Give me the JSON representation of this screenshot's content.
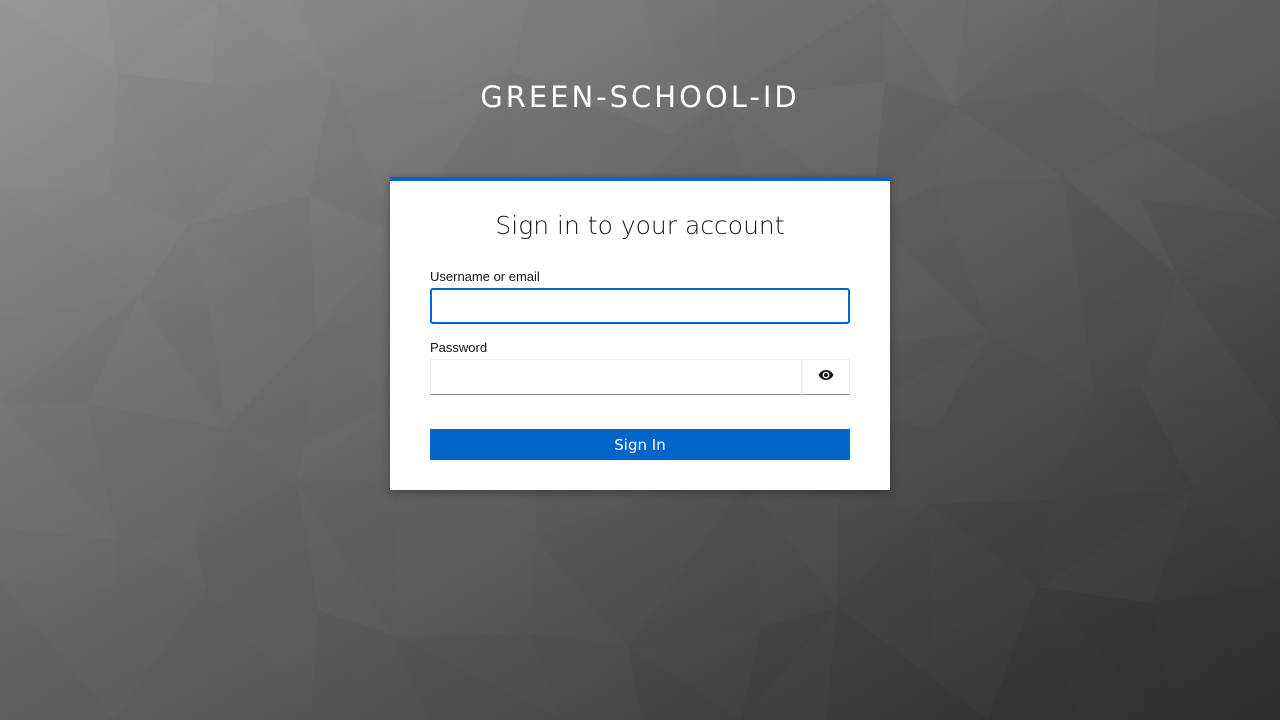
{
  "brand": {
    "title": "GREEN-SCHOOL-ID"
  },
  "login": {
    "heading": "Sign in to your account",
    "username_label": "Username or email",
    "username_value": "",
    "password_label": "Password",
    "password_value": "",
    "toggle_icon": "eye-icon",
    "submit_label": "Sign In"
  },
  "colors": {
    "accent": "#0066cc",
    "card_bg": "#ffffff",
    "text": "#151515"
  }
}
